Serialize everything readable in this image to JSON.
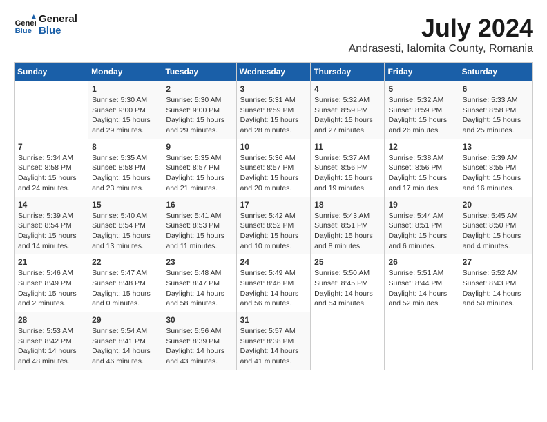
{
  "logo": {
    "line1": "General",
    "line2": "Blue"
  },
  "title": "July 2024",
  "location": "Andrasesti, Ialomita County, Romania",
  "days_of_week": [
    "Sunday",
    "Monday",
    "Tuesday",
    "Wednesday",
    "Thursday",
    "Friday",
    "Saturday"
  ],
  "weeks": [
    [
      {
        "day": "",
        "info": ""
      },
      {
        "day": "1",
        "info": "Sunrise: 5:30 AM\nSunset: 9:00 PM\nDaylight: 15 hours\nand 29 minutes."
      },
      {
        "day": "2",
        "info": "Sunrise: 5:30 AM\nSunset: 9:00 PM\nDaylight: 15 hours\nand 29 minutes."
      },
      {
        "day": "3",
        "info": "Sunrise: 5:31 AM\nSunset: 8:59 PM\nDaylight: 15 hours\nand 28 minutes."
      },
      {
        "day": "4",
        "info": "Sunrise: 5:32 AM\nSunset: 8:59 PM\nDaylight: 15 hours\nand 27 minutes."
      },
      {
        "day": "5",
        "info": "Sunrise: 5:32 AM\nSunset: 8:59 PM\nDaylight: 15 hours\nand 26 minutes."
      },
      {
        "day": "6",
        "info": "Sunrise: 5:33 AM\nSunset: 8:58 PM\nDaylight: 15 hours\nand 25 minutes."
      }
    ],
    [
      {
        "day": "7",
        "info": "Sunrise: 5:34 AM\nSunset: 8:58 PM\nDaylight: 15 hours\nand 24 minutes."
      },
      {
        "day": "8",
        "info": "Sunrise: 5:35 AM\nSunset: 8:58 PM\nDaylight: 15 hours\nand 23 minutes."
      },
      {
        "day": "9",
        "info": "Sunrise: 5:35 AM\nSunset: 8:57 PM\nDaylight: 15 hours\nand 21 minutes."
      },
      {
        "day": "10",
        "info": "Sunrise: 5:36 AM\nSunset: 8:57 PM\nDaylight: 15 hours\nand 20 minutes."
      },
      {
        "day": "11",
        "info": "Sunrise: 5:37 AM\nSunset: 8:56 PM\nDaylight: 15 hours\nand 19 minutes."
      },
      {
        "day": "12",
        "info": "Sunrise: 5:38 AM\nSunset: 8:56 PM\nDaylight: 15 hours\nand 17 minutes."
      },
      {
        "day": "13",
        "info": "Sunrise: 5:39 AM\nSunset: 8:55 PM\nDaylight: 15 hours\nand 16 minutes."
      }
    ],
    [
      {
        "day": "14",
        "info": "Sunrise: 5:39 AM\nSunset: 8:54 PM\nDaylight: 15 hours\nand 14 minutes."
      },
      {
        "day": "15",
        "info": "Sunrise: 5:40 AM\nSunset: 8:54 PM\nDaylight: 15 hours\nand 13 minutes."
      },
      {
        "day": "16",
        "info": "Sunrise: 5:41 AM\nSunset: 8:53 PM\nDaylight: 15 hours\nand 11 minutes."
      },
      {
        "day": "17",
        "info": "Sunrise: 5:42 AM\nSunset: 8:52 PM\nDaylight: 15 hours\nand 10 minutes."
      },
      {
        "day": "18",
        "info": "Sunrise: 5:43 AM\nSunset: 8:51 PM\nDaylight: 15 hours\nand 8 minutes."
      },
      {
        "day": "19",
        "info": "Sunrise: 5:44 AM\nSunset: 8:51 PM\nDaylight: 15 hours\nand 6 minutes."
      },
      {
        "day": "20",
        "info": "Sunrise: 5:45 AM\nSunset: 8:50 PM\nDaylight: 15 hours\nand 4 minutes."
      }
    ],
    [
      {
        "day": "21",
        "info": "Sunrise: 5:46 AM\nSunset: 8:49 PM\nDaylight: 15 hours\nand 2 minutes."
      },
      {
        "day": "22",
        "info": "Sunrise: 5:47 AM\nSunset: 8:48 PM\nDaylight: 15 hours\nand 0 minutes."
      },
      {
        "day": "23",
        "info": "Sunrise: 5:48 AM\nSunset: 8:47 PM\nDaylight: 14 hours\nand 58 minutes."
      },
      {
        "day": "24",
        "info": "Sunrise: 5:49 AM\nSunset: 8:46 PM\nDaylight: 14 hours\nand 56 minutes."
      },
      {
        "day": "25",
        "info": "Sunrise: 5:50 AM\nSunset: 8:45 PM\nDaylight: 14 hours\nand 54 minutes."
      },
      {
        "day": "26",
        "info": "Sunrise: 5:51 AM\nSunset: 8:44 PM\nDaylight: 14 hours\nand 52 minutes."
      },
      {
        "day": "27",
        "info": "Sunrise: 5:52 AM\nSunset: 8:43 PM\nDaylight: 14 hours\nand 50 minutes."
      }
    ],
    [
      {
        "day": "28",
        "info": "Sunrise: 5:53 AM\nSunset: 8:42 PM\nDaylight: 14 hours\nand 48 minutes."
      },
      {
        "day": "29",
        "info": "Sunrise: 5:54 AM\nSunset: 8:41 PM\nDaylight: 14 hours\nand 46 minutes."
      },
      {
        "day": "30",
        "info": "Sunrise: 5:56 AM\nSunset: 8:39 PM\nDaylight: 14 hours\nand 43 minutes."
      },
      {
        "day": "31",
        "info": "Sunrise: 5:57 AM\nSunset: 8:38 PM\nDaylight: 14 hours\nand 41 minutes."
      },
      {
        "day": "",
        "info": ""
      },
      {
        "day": "",
        "info": ""
      },
      {
        "day": "",
        "info": ""
      }
    ]
  ]
}
